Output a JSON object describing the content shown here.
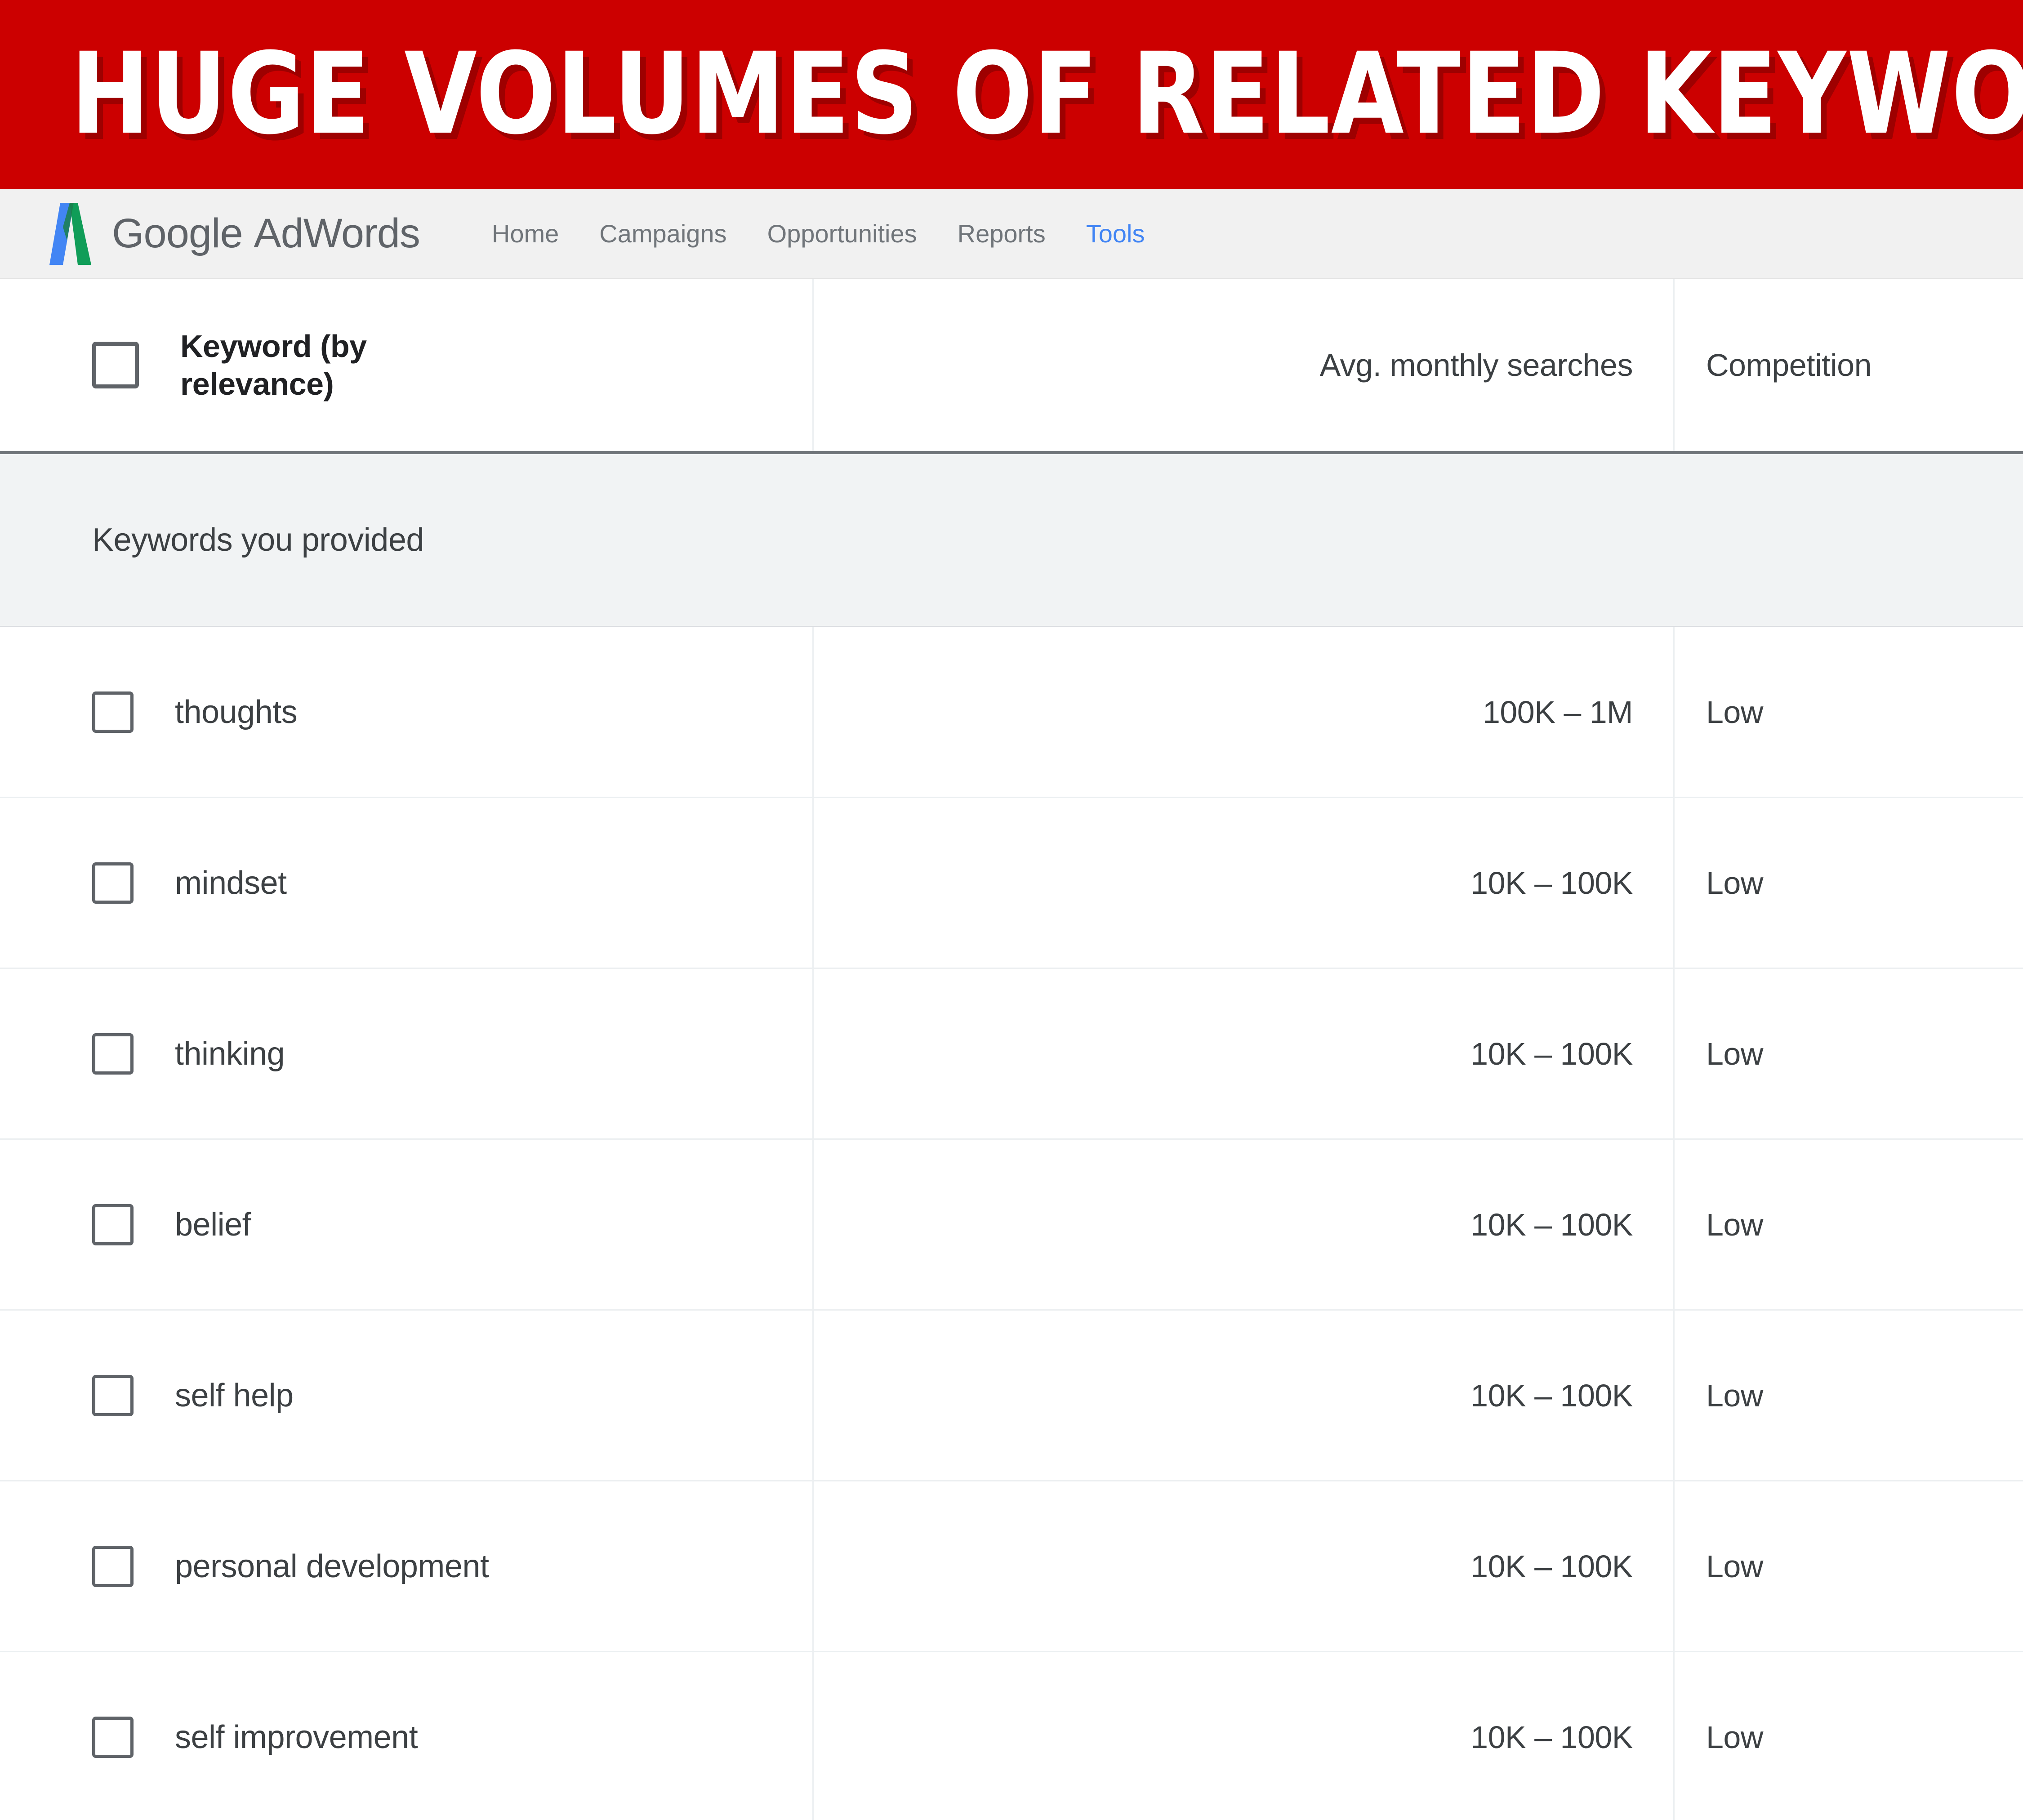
{
  "banner": {
    "text": "HUGE VOLUMES OF RELATED KEYWORDS",
    "background_color": "#cc0000",
    "text_color": "#ffffff"
  },
  "navbar": {
    "brand_google": "Google",
    "brand_product": "AdWords",
    "logo_blue": "#4285f4",
    "logo_green": "#109d58",
    "active_color": "#4285f4",
    "links": [
      {
        "label": "Home",
        "active": false
      },
      {
        "label": "Campaigns",
        "active": false
      },
      {
        "label": "Opportunities",
        "active": false
      },
      {
        "label": "Reports",
        "active": false
      },
      {
        "label": "Tools",
        "active": true
      }
    ]
  },
  "table": {
    "columns": {
      "keyword": "Keyword (by relevance)",
      "keyword_line1": "Keyword (by",
      "keyword_line2": "relevance)",
      "avg_monthly_searches": "Avg. monthly searches",
      "competition": "Competition"
    },
    "section_label": "Keywords you provided",
    "rows": [
      {
        "keyword": "thoughts",
        "avg_monthly_searches": "100K – 1M",
        "competition": "Low"
      },
      {
        "keyword": "mindset",
        "avg_monthly_searches": "10K – 100K",
        "competition": "Low"
      },
      {
        "keyword": "thinking",
        "avg_monthly_searches": "10K – 100K",
        "competition": "Low"
      },
      {
        "keyword": "belief",
        "avg_monthly_searches": "10K – 100K",
        "competition": "Low"
      },
      {
        "keyword": "self help",
        "avg_monthly_searches": "10K – 100K",
        "competition": "Low"
      },
      {
        "keyword": "personal development",
        "avg_monthly_searches": "10K – 100K",
        "competition": "Low"
      },
      {
        "keyword": "self improvement",
        "avg_monthly_searches": "10K – 100K",
        "competition": "Low"
      }
    ]
  }
}
